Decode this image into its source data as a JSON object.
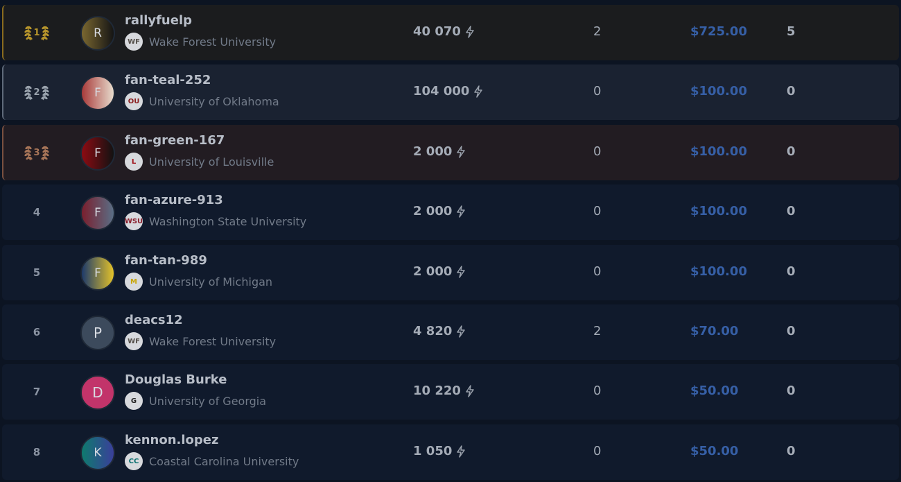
{
  "leaderboard": {
    "rows": [
      {
        "rank": "1",
        "medal": "gold",
        "initial": "R",
        "avatar_colors": [
          "#7a6730",
          "#151515"
        ],
        "username": "rallyfuelp",
        "logo": "WF",
        "logo_color": "#55504a",
        "school": "Wake Forest University",
        "points": "40 070",
        "count": "2",
        "prize": "$725.00",
        "last": "5"
      },
      {
        "rank": "2",
        "medal": "silver",
        "initial": "F",
        "avatar_colors": [
          "#a83a3a",
          "#e7dccd"
        ],
        "username": "fan-teal-252",
        "logo": "OU",
        "logo_color": "#8b1d1d",
        "school": "University of Oklahoma",
        "points": "104 000",
        "count": "0",
        "prize": "$100.00",
        "last": "0"
      },
      {
        "rank": "3",
        "medal": "bronze",
        "initial": "F",
        "avatar_colors": [
          "#8c0b12",
          "#121212"
        ],
        "username": "fan-green-167",
        "logo": "L",
        "logo_color": "#a0121a",
        "school": "University of Louisville",
        "points": "2 000",
        "count": "0",
        "prize": "$100.00",
        "last": "0"
      },
      {
        "rank": "4",
        "medal": "",
        "initial": "F",
        "avatar_colors": [
          "#7a1f2e",
          "#5a6f86"
        ],
        "username": "fan-azure-913",
        "logo": "WSU",
        "logo_color": "#8a1e2c",
        "school": "Washington State University",
        "points": "2 000",
        "count": "0",
        "prize": "$100.00",
        "last": "0"
      },
      {
        "rank": "5",
        "medal": "",
        "initial": "F",
        "avatar_colors": [
          "#1d3a6b",
          "#e3c22a"
        ],
        "username": "fan-tan-989",
        "logo": "M",
        "logo_color": "#c9a500",
        "school": "University of Michigan",
        "points": "2 000",
        "count": "0",
        "prize": "$100.00",
        "last": "0"
      },
      {
        "rank": "6",
        "medal": "",
        "initial": "P",
        "avatar_colors": [
          "#3c4a5c",
          "#3c4a5c"
        ],
        "username": "deacs12",
        "logo": "WF",
        "logo_color": "#55504a",
        "school": "Wake Forest University",
        "points": "4 820",
        "count": "2",
        "prize": "$70.00",
        "last": "0"
      },
      {
        "rank": "7",
        "medal": "",
        "initial": "D",
        "avatar_colors": [
          "#c2346a",
          "#c2346a"
        ],
        "username": "Douglas Burke",
        "logo": "G",
        "logo_color": "#222222",
        "school": "University of Georgia",
        "points": "10 220",
        "count": "0",
        "prize": "$50.00",
        "last": "0"
      },
      {
        "rank": "8",
        "medal": "",
        "initial": "K",
        "avatar_colors": [
          "#0f7a6e",
          "#3a3f9a"
        ],
        "username": "kennon.lopez",
        "logo": "CC",
        "logo_color": "#0a6f6f",
        "school": "Coastal Carolina University",
        "points": "1 050",
        "count": "0",
        "prize": "$50.00",
        "last": "0"
      }
    ]
  },
  "colors": {
    "gold": "#b8962c",
    "silver": "#9aa3ad",
    "bronze": "#a87558",
    "accent_link": "#365fa6"
  },
  "icons": {
    "points": "lightning-bolt-icon",
    "medal": "laurel-wreath-icon"
  }
}
